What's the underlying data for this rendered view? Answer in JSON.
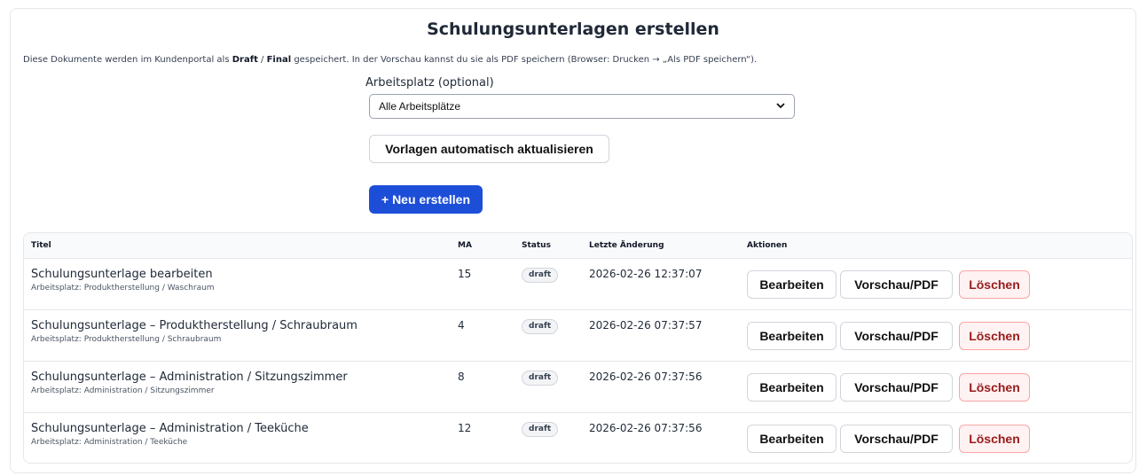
{
  "page": {
    "title": "Schulungsunterlagen erstellen",
    "subtitle_part1": "Diese Dokumente werden im Kundenportal als ",
    "subtitle_draft": "Draft",
    "subtitle_sep": " / ",
    "subtitle_final": "Final",
    "subtitle_part2": " gespeichert. In der Vorschau kannst du sie als PDF speichern (Browser: Drucken → „Als PDF speichern“)."
  },
  "filter": {
    "label": "Arbeitsplatz (optional)",
    "selected": "Alle Arbeitsplätze"
  },
  "buttons": {
    "update_templates": "Vorlagen automatisch aktualisieren",
    "create_new": "+ Neu erstellen"
  },
  "table": {
    "headers": {
      "title": "Titel",
      "ma": "MA",
      "status": "Status",
      "last_change": "Letzte Änderung",
      "actions": "Aktionen"
    },
    "action_labels": {
      "edit": "Bearbeiten",
      "preview": "Vorschau/PDF",
      "delete": "Löschen"
    },
    "rows": [
      {
        "title": "Schulungsunterlage bearbeiten",
        "workplace": "Arbeitsplatz: Produktherstellung / Waschraum",
        "ma": "15",
        "status": "draft",
        "last_change": "2026-02-26 12:37:07"
      },
      {
        "title": "Schulungsunterlage – Produktherstellung / Schraubraum",
        "workplace": "Arbeitsplatz: Produktherstellung / Schraubraum",
        "ma": "4",
        "status": "draft",
        "last_change": "2026-02-26 07:37:57"
      },
      {
        "title": "Schulungsunterlage – Administration / Sitzungszimmer",
        "workplace": "Arbeitsplatz: Administration / Sitzungszimmer",
        "ma": "8",
        "status": "draft",
        "last_change": "2026-02-26 07:37:56"
      },
      {
        "title": "Schulungsunterlage – Administration / Teeküche",
        "workplace": "Arbeitsplatz: Administration / Teeküche",
        "ma": "12",
        "status": "draft",
        "last_change": "2026-02-26 07:37:56"
      }
    ]
  },
  "colors": {
    "primary": "#1d4ed8",
    "danger_text": "#991b1b",
    "danger_bg": "#fef2f2",
    "danger_border": "#fca5a5"
  },
  "icons": {
    "select_chevron": "chevron-down-icon"
  }
}
